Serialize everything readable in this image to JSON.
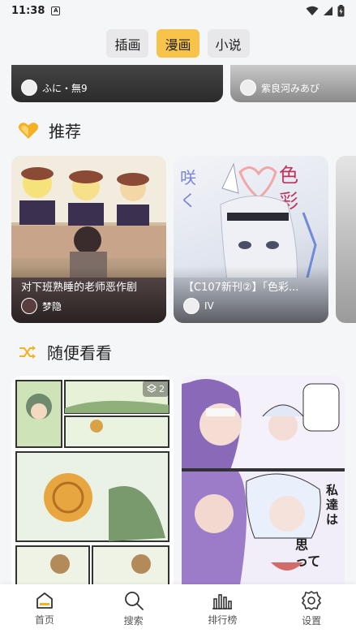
{
  "status_bar": {
    "time": "11:38",
    "sim_label": "A"
  },
  "top_tabs": [
    {
      "label": "插画",
      "active": false
    },
    {
      "label": "漫画",
      "active": true
    },
    {
      "label": "小说",
      "active": false
    }
  ],
  "partial_cards": [
    {
      "author": "ふに・無9"
    },
    {
      "author": "紫良河みあび"
    }
  ],
  "recommend": {
    "title": "推荐",
    "icon": "heart-icon",
    "icon_color": "#f5b025",
    "cards": [
      {
        "title": "对下班熟睡的老师恶作剧",
        "author": "梦隐"
      },
      {
        "title": "【C107新刊②】「色彩...",
        "author": "IV"
      },
      {
        "title": "",
        "author": ""
      }
    ]
  },
  "random": {
    "title": "随便看看",
    "icon": "shuffle-icon",
    "icon_color": "#f5b025",
    "cards": [
      {
        "page_count": "2"
      },
      {
        "page_count": ""
      }
    ]
  },
  "bottom_nav": [
    {
      "label": "首页",
      "icon": "home-icon"
    },
    {
      "label": "搜索",
      "icon": "search-icon"
    },
    {
      "label": "排行榜",
      "icon": "ranking-icon"
    },
    {
      "label": "设置",
      "icon": "gear-icon"
    }
  ]
}
